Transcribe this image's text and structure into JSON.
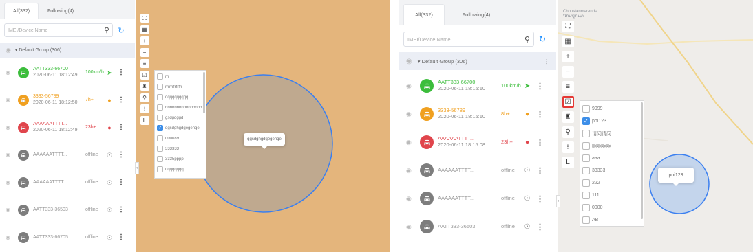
{
  "colors": {
    "accent": "#1e8fff",
    "online": "#3cbd3c",
    "idle": "#f0a020",
    "alarm": "#e0454c",
    "offline": "#999999",
    "map_left_bg": "#e4b57c",
    "geofence_left_fill": "#bfa98f",
    "geofence_right_fill": "#c4d5ec",
    "geofence_stroke": "#3a7ff0",
    "checkbox_checked": "#3d8ee8",
    "selected_tool_border": "#e53935"
  },
  "left": {
    "tabs": [
      {
        "label": "All(332)",
        "active": true
      },
      {
        "label": "Following(4)",
        "active": false
      }
    ],
    "search_placeholder": "IMEI/Device Name",
    "group": {
      "label": "▾ Default Group (306)"
    },
    "devices": [
      {
        "name": "AATT333-66700",
        "time": "2020-06-11 18:12:49",
        "status": "100km/h",
        "state": "online",
        "icon": "send-icon",
        "name_color": "green"
      },
      {
        "name": "3333-56789",
        "time": "2020-06-11 18:12:50",
        "status": "7h+",
        "state": "idle",
        "icon": "alert-icon",
        "name_color": "orange"
      },
      {
        "name": "AAAAAATTTT...",
        "time": "2020-06-11 18:12:49",
        "status": "23h+",
        "state": "alarm",
        "icon": "alarm-icon",
        "name_color": "red"
      },
      {
        "name": "AAAAAATTTT...",
        "time": "",
        "status": "offline",
        "state": "offline",
        "icon": "location-icon",
        "name_color": "grey"
      },
      {
        "name": "AAAAAATTTT...",
        "time": "",
        "status": "offline",
        "state": "offline",
        "icon": "location-icon",
        "name_color": "grey"
      },
      {
        "name": "AATT333-36503",
        "time": "",
        "status": "offline",
        "state": "offline",
        "icon": "location-icon",
        "name_color": "grey"
      },
      {
        "name": "AATT333-66705",
        "time": "",
        "status": "offline",
        "state": "offline",
        "icon": "location-icon",
        "name_color": "grey"
      }
    ],
    "poi_list": [
      {
        "label": "rrr",
        "checked": false
      },
      {
        "label": "rrrrrrfrfrfrr",
        "checked": false
      },
      {
        "label": "qqqqqqqqqq",
        "checked": false
      },
      {
        "label": "bbbbbbbbbbbbbbbb",
        "checked": false
      },
      {
        "label": "gsdgdggd",
        "checked": false
      },
      {
        "label": "qgsdghgdgegenge",
        "checked": true
      },
      {
        "label": "000089",
        "checked": false
      },
      {
        "label": "333333",
        "checked": false
      },
      {
        "label": "3335pppp",
        "checked": false
      },
      {
        "label": "qqqqqqqq",
        "checked": false
      }
    ],
    "popup_label": "qgsdghgdgegenge"
  },
  "right": {
    "tabs": [
      {
        "label": "All(332)",
        "active": true
      },
      {
        "label": "Following(4)",
        "active": false
      }
    ],
    "search_placeholder": "IMEI/Device Name",
    "group": {
      "label": "▾ Default Group (306)"
    },
    "devices": [
      {
        "name": "AATT333-66700",
        "time": "2020-06-11 18:15:10",
        "status": "100km/h",
        "state": "online",
        "icon": "send-icon",
        "name_color": "green"
      },
      {
        "name": "3333-56789",
        "time": "2020-06-11 18:15:10",
        "status": "8h+",
        "state": "idle",
        "icon": "alert-icon",
        "name_color": "orange"
      },
      {
        "name": "AAAAAATTTT...",
        "time": "2020-06-11 18:15:08",
        "status": "23h+",
        "state": "alarm",
        "icon": "alarm-icon",
        "name_color": "red"
      },
      {
        "name": "AAAAAATTTT...",
        "time": "",
        "status": "offline",
        "state": "offline",
        "icon": "location-icon",
        "name_color": "grey"
      },
      {
        "name": "AAAAAATTTT...",
        "time": "",
        "status": "offline",
        "state": "offline",
        "icon": "location-icon",
        "name_color": "grey"
      },
      {
        "name": "AATT333-36503",
        "time": "",
        "status": "offline",
        "state": "offline",
        "icon": "location-icon",
        "name_color": "grey"
      }
    ],
    "poi_list": [
      {
        "label": "9999",
        "checked": false
      },
      {
        "label": "poi123",
        "checked": true
      },
      {
        "label": "请问请问",
        "checked": false
      },
      {
        "label": "啊啊啊啊",
        "checked": false
      },
      {
        "label": "aaa",
        "checked": false
      },
      {
        "label": "33333",
        "checked": false
      },
      {
        "label": "222",
        "checked": false
      },
      {
        "label": "111",
        "checked": false
      },
      {
        "label": "0000",
        "checked": false
      },
      {
        "label": "AB",
        "checked": false
      }
    ],
    "popup_label": "poi123",
    "map_place": [
      "Choustanmarends",
      "Ղուրշուտ"
    ]
  },
  "toolbar": [
    {
      "name": "fullscreen-icon",
      "glyph": "⛶"
    },
    {
      "name": "map-layer-icon",
      "glyph": "▦"
    },
    {
      "name": "zoom-in-icon",
      "glyph": "+"
    },
    {
      "name": "zoom-out-icon",
      "glyph": "−"
    },
    {
      "name": "ruler-icon",
      "glyph": "≡"
    },
    {
      "name": "poi-icon",
      "glyph": "☑"
    },
    {
      "name": "binoculars-icon",
      "glyph": "♜"
    },
    {
      "name": "location-pin-icon",
      "glyph": "⚲"
    },
    {
      "name": "traffic-light-icon",
      "glyph": "⁝"
    },
    {
      "name": "measure-l-icon",
      "glyph": "L"
    }
  ]
}
